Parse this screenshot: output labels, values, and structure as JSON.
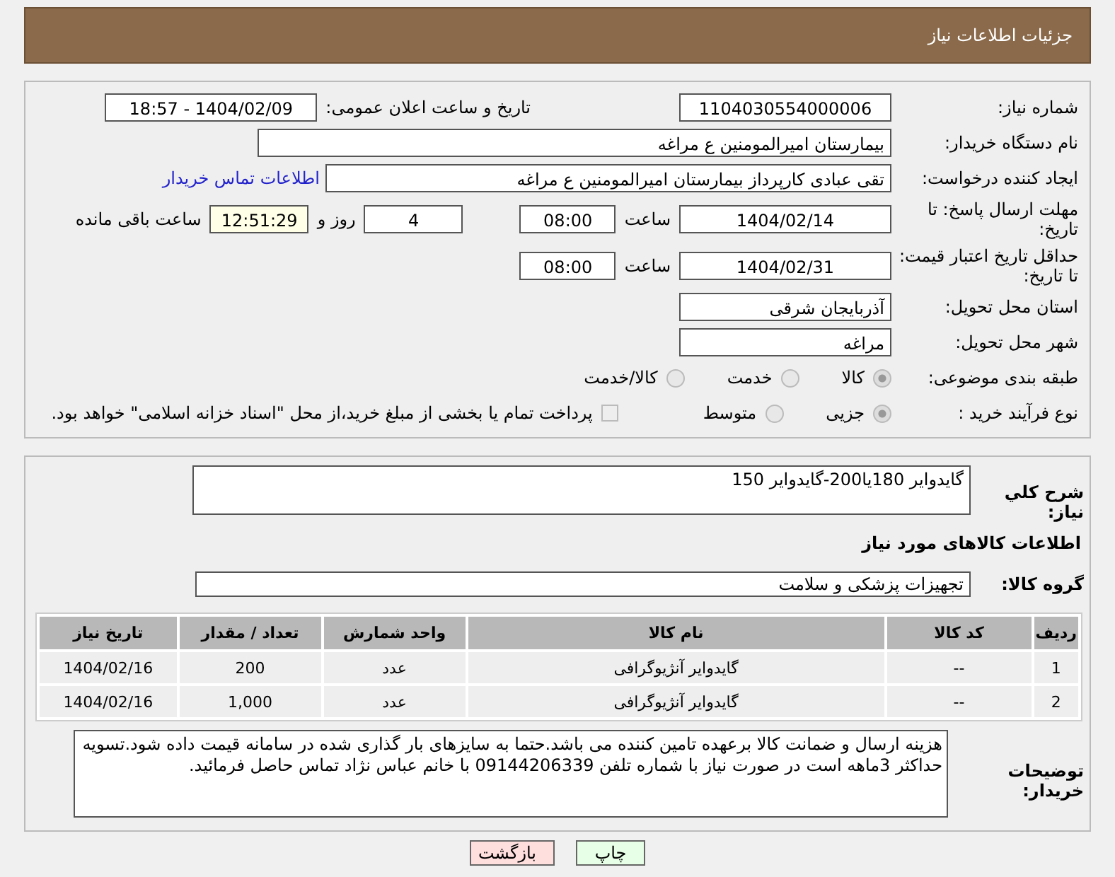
{
  "page_title": "جزئیات اطلاعات نیاز",
  "need_number": {
    "label": "شماره نیاز:",
    "value": "1104030554000006"
  },
  "announce": {
    "label": "تاریخ و ساعت اعلان عمومی:",
    "value": "1404/02/09 - 18:57"
  },
  "buyer_org": {
    "label": "نام دستگاه خریدار:",
    "value": "بیمارستان امیرالمومنین ع  مراغه"
  },
  "requester": {
    "label": "ایجاد کننده درخواست:",
    "value": "تقی عبادی کارپرداز بیمارستان امیرالمومنین ع  مراغه",
    "link": "اطلاعات تماس خریدار"
  },
  "deadline": {
    "label": "مهلت ارسال پاسخ: تا تاریخ:",
    "date": "1404/02/14",
    "time_label": "ساعت",
    "time": "08:00",
    "days": "4",
    "days_label": "روز و",
    "remaining": "12:51:29",
    "remaining_label": "ساعت باقی مانده"
  },
  "validity": {
    "label": "حداقل تاریخ اعتبار قیمت: تا تاریخ:",
    "date": "1404/02/31",
    "time_label": "ساعت",
    "time": "08:00"
  },
  "province": {
    "label": "استان محل تحویل:",
    "value": "آذربایجان شرقی"
  },
  "city": {
    "label": "شهر محل تحویل:",
    "value": "مراغه"
  },
  "category": {
    "label": "طبقه بندی موضوعی:",
    "options": [
      {
        "label": "کالا",
        "selected": true
      },
      {
        "label": "خدمت",
        "selected": false
      },
      {
        "label": "کالا/خدمت",
        "selected": false
      }
    ]
  },
  "process": {
    "label": "نوع فرآیند خرید :",
    "options": [
      {
        "label": "جزیی",
        "selected": true
      },
      {
        "label": "متوسط",
        "selected": false
      }
    ],
    "payment": {
      "text": "پرداخت تمام یا بخشی از مبلغ خرید،از محل \"اسناد خزانه اسلامی\" خواهد بود.",
      "checked": false
    }
  },
  "description": {
    "label": "شرح کلي نیاز:",
    "value": "گایدوایر 180یا200-گایدوایر 150"
  },
  "goods_heading": "اطلاعات کالاهای مورد نیاز",
  "goods_group": {
    "label": "گروه کالا:",
    "value": "تجهیزات پزشکی و سلامت"
  },
  "table": {
    "columns": [
      "ردیف",
      "کد کالا",
      "نام کالا",
      "واحد شمارش",
      "تعداد / مقدار",
      "تاریخ نیاز"
    ],
    "rows": [
      [
        "1",
        "--",
        "گایدوایر آنژیوگرافی",
        "عدد",
        "200",
        "1404/02/16"
      ],
      [
        "2",
        "--",
        "گایدوایر آنژیوگرافی",
        "عدد",
        "1,000",
        "1404/02/16"
      ]
    ]
  },
  "buyer_notes": {
    "label": "توضیحات خریدار:",
    "value": "هزینه ارسال و ضمانت کالا برعهده تامین کننده می باشد.حتما به سایزهای بار گذاری شده در سامانه قیمت داده شود.تسویه حداکثر 3ماهه است در صورت نیاز با شماره تلفن 09144206339 با خانم عباس نژاد تماس حاصل فرمائید."
  },
  "buttons": [
    {
      "label": "چاپ",
      "kind": "print"
    },
    {
      "label": "بازگشت",
      "kind": "back"
    }
  ]
}
